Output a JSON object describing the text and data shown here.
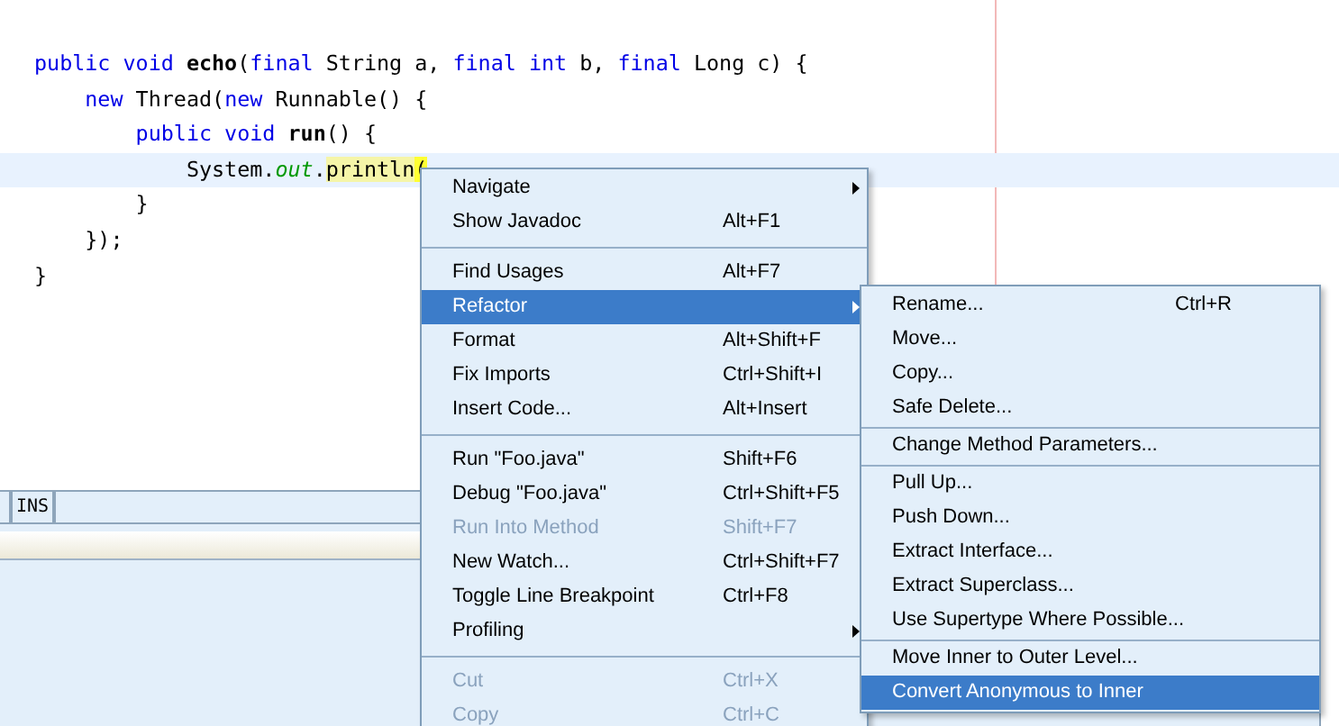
{
  "editor": {
    "lines": [
      {
        "current": false,
        "tokens": [
          {
            "kind": "keyword",
            "text": "public void"
          },
          {
            "kind": "method",
            "text": " echo"
          },
          {
            "kind": "plain",
            "text": "("
          },
          {
            "kind": "keyword",
            "text": "final"
          },
          {
            "kind": "plain",
            "text": " String a, "
          },
          {
            "kind": "keyword",
            "text": "final int"
          },
          {
            "kind": "plain",
            "text": " b, "
          },
          {
            "kind": "keyword",
            "text": "final"
          },
          {
            "kind": "plain",
            "text": " Long c) {"
          }
        ]
      },
      {
        "current": false,
        "tokens": [
          {
            "kind": "keyword",
            "text": "    new"
          },
          {
            "kind": "plain",
            "text": " Thread("
          },
          {
            "kind": "keyword",
            "text": "new"
          },
          {
            "kind": "plain",
            "text": " Runnable() {"
          }
        ]
      },
      {
        "current": false,
        "tokens": [
          {
            "kind": "keyword",
            "text": "        public void"
          },
          {
            "kind": "method",
            "text": " run"
          },
          {
            "kind": "plain",
            "text": "() {"
          }
        ]
      },
      {
        "current": true,
        "tokens": [
          {
            "kind": "plain",
            "text": "            System."
          },
          {
            "kind": "field",
            "text": "out"
          },
          {
            "kind": "plain",
            "text": "."
          },
          {
            "kind": "highlight",
            "text": "println"
          },
          {
            "kind": "match",
            "text": "("
          }
        ]
      },
      {
        "current": false,
        "tokens": [
          {
            "kind": "plain",
            "text": "        }"
          }
        ]
      },
      {
        "current": false,
        "tokens": [
          {
            "kind": "plain",
            "text": "    });"
          }
        ]
      },
      {
        "current": false,
        "tokens": [
          {
            "kind": "plain",
            "text": "}"
          }
        ]
      }
    ]
  },
  "status_bar": {
    "mode": "INS"
  },
  "context_menu": {
    "items": [
      {
        "kind": "item",
        "label": "Navigate",
        "submenu": true,
        "selected": false,
        "disabled": false
      },
      {
        "kind": "item",
        "label": "Show Javadoc",
        "shortcut": "Alt+F1",
        "submenu": false,
        "selected": false,
        "disabled": false
      },
      {
        "kind": "separator"
      },
      {
        "kind": "item",
        "label": "Find Usages",
        "shortcut": "Alt+F7",
        "submenu": false,
        "selected": false,
        "disabled": false
      },
      {
        "kind": "item",
        "label": "Refactor",
        "submenu": true,
        "selected": true,
        "disabled": false
      },
      {
        "kind": "item",
        "label": "Format",
        "shortcut": "Alt+Shift+F",
        "submenu": false,
        "selected": false,
        "disabled": false
      },
      {
        "kind": "item",
        "label": "Fix Imports",
        "shortcut": "Ctrl+Shift+I",
        "submenu": false,
        "selected": false,
        "disabled": false
      },
      {
        "kind": "item",
        "label": "Insert Code...",
        "shortcut": "Alt+Insert",
        "submenu": false,
        "selected": false,
        "disabled": false
      },
      {
        "kind": "separator"
      },
      {
        "kind": "item",
        "label": "Run \"Foo.java\"",
        "shortcut": "Shift+F6",
        "submenu": false,
        "selected": false,
        "disabled": false
      },
      {
        "kind": "item",
        "label": "Debug \"Foo.java\"",
        "shortcut": "Ctrl+Shift+F5",
        "submenu": false,
        "selected": false,
        "disabled": false
      },
      {
        "kind": "item",
        "label": "Run Into Method",
        "shortcut": "Shift+F7",
        "submenu": false,
        "selected": false,
        "disabled": true
      },
      {
        "kind": "item",
        "label": "New Watch...",
        "shortcut": "Ctrl+Shift+F7",
        "submenu": false,
        "selected": false,
        "disabled": false
      },
      {
        "kind": "item",
        "label": "Toggle Line Breakpoint",
        "shortcut": "Ctrl+F8",
        "submenu": false,
        "selected": false,
        "disabled": false
      },
      {
        "kind": "item",
        "label": "Profiling",
        "submenu": true,
        "selected": false,
        "disabled": false
      },
      {
        "kind": "separator"
      },
      {
        "kind": "item",
        "label": "Cut",
        "shortcut": "Ctrl+X",
        "submenu": false,
        "selected": false,
        "disabled": true
      },
      {
        "kind": "item",
        "label": "Copy",
        "shortcut": "Ctrl+C",
        "submenu": false,
        "selected": false,
        "disabled": true
      }
    ]
  },
  "refactor_submenu": {
    "items": [
      {
        "kind": "item",
        "label": "Rename...",
        "shortcut": "Ctrl+R",
        "submenu": false,
        "selected": false,
        "disabled": false
      },
      {
        "kind": "item",
        "label": "Move...",
        "submenu": false,
        "selected": false,
        "disabled": false
      },
      {
        "kind": "item",
        "label": "Copy...",
        "submenu": false,
        "selected": false,
        "disabled": false
      },
      {
        "kind": "item",
        "label": "Safe Delete...",
        "submenu": false,
        "selected": false,
        "disabled": false
      },
      {
        "kind": "separator"
      },
      {
        "kind": "item",
        "label": "Change Method Parameters...",
        "submenu": false,
        "selected": false,
        "disabled": false
      },
      {
        "kind": "separator"
      },
      {
        "kind": "item",
        "label": "Pull Up...",
        "submenu": false,
        "selected": false,
        "disabled": false
      },
      {
        "kind": "item",
        "label": "Push Down...",
        "submenu": false,
        "selected": false,
        "disabled": false
      },
      {
        "kind": "item",
        "label": "Extract Interface...",
        "submenu": false,
        "selected": false,
        "disabled": false
      },
      {
        "kind": "item",
        "label": "Extract Superclass...",
        "submenu": false,
        "selected": false,
        "disabled": false
      },
      {
        "kind": "item",
        "label": "Use Supertype Where Possible...",
        "submenu": false,
        "selected": false,
        "disabled": false
      },
      {
        "kind": "separator"
      },
      {
        "kind": "item",
        "label": "Move Inner to Outer Level...",
        "submenu": false,
        "selected": false,
        "disabled": false
      },
      {
        "kind": "item",
        "label": "Convert Anonymous to Inner",
        "submenu": false,
        "selected": true,
        "disabled": false
      }
    ]
  }
}
